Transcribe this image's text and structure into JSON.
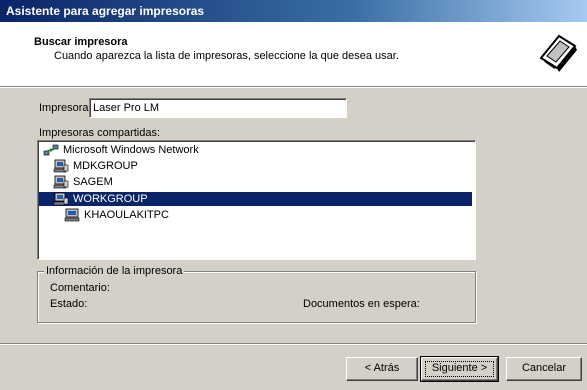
{
  "window": {
    "title": "Asistente para agregar impresoras"
  },
  "header": {
    "title": "Buscar impresora",
    "subtitle": "Cuando aparezca la lista de impresoras, seleccione la que desea usar."
  },
  "printer_field": {
    "label": "Impresora:",
    "value": "Laser Pro LM"
  },
  "shared": {
    "label": "Impresoras compartidas:",
    "items": [
      {
        "label": "Microsoft Windows Network",
        "icon": "network-icon"
      },
      {
        "label": "MDKGROUP",
        "icon": "workgroup-icon"
      },
      {
        "label": "SAGEM",
        "icon": "workgroup-icon"
      },
      {
        "label": "WORKGROUP",
        "icon": "workgroup-icon",
        "selected": true
      },
      {
        "label": "KHAOULAKITPC",
        "icon": "computer-icon"
      }
    ]
  },
  "info": {
    "title": "Información de la impresora",
    "comment_label": "Comentario:",
    "status_label": "Estado:",
    "docs_label": "Documentos en espera:"
  },
  "buttons": {
    "back": "< Atrás",
    "next": "Siguiente >",
    "cancel": "Cancelar"
  },
  "colors": {
    "selection": "#0a246a",
    "face": "#d4d0c8"
  }
}
